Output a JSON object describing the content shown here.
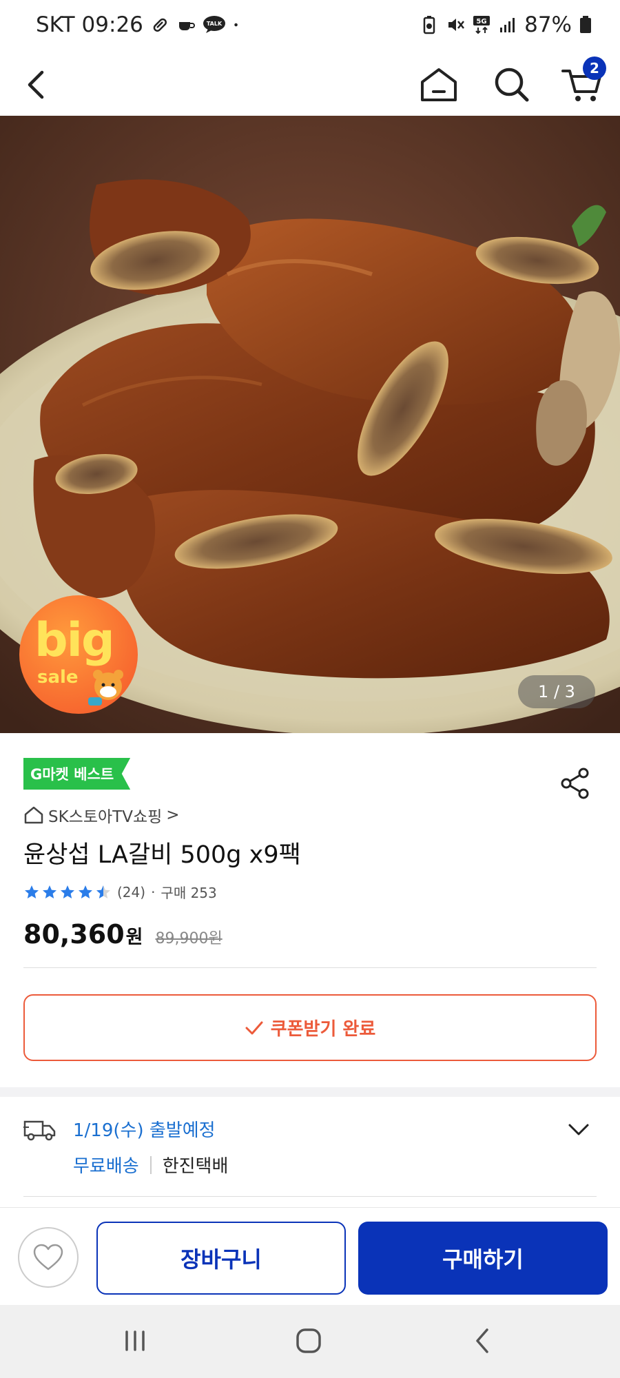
{
  "status_bar": {
    "carrier": "SKT",
    "time": "09:26",
    "talk_label": "TALK",
    "network": "5G",
    "battery": "87%"
  },
  "header": {
    "cart_count": "2"
  },
  "product_image": {
    "counter": "1 / 3",
    "promo_badge": {
      "line1": "big",
      "line2": "sale"
    }
  },
  "product": {
    "best_badge": "G마켓 베스트",
    "seller": "SK스토아TV쇼핑",
    "seller_arrow": ">",
    "title": "윤상섭 LA갈비 500g x9팩",
    "rating": {
      "stars": 4.5,
      "review_count": "(24)",
      "separator": "·",
      "purchases": "구매 253"
    },
    "price": "80,360",
    "price_unit": "원",
    "original_price": "89,900원"
  },
  "coupon": {
    "label": "쿠폰받기 완료"
  },
  "delivery": {
    "ship_date": "1/19(수) 출발예정",
    "shipping_fee": "무료배송",
    "courier": "한진택배"
  },
  "actions": {
    "cart_label": "장바구니",
    "buy_label": "구매하기"
  },
  "colors": {
    "brand_blue": "#0a33b8",
    "link_blue": "#1a6fd0",
    "coupon_red": "#ec5a3a",
    "best_green": "#29c04a"
  }
}
